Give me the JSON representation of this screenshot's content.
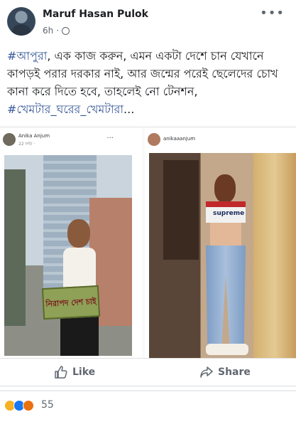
{
  "post": {
    "author": "Maruf Hasan Pulok",
    "time": "6h",
    "dot": "·",
    "more": "•••",
    "text": {
      "hashtag1": "#আপুরা",
      "body": ", এক কাজ করুন, এমন একটা দেশে চান যেখানে কাপড়ই পরার দরকার নাই, আর জন্মের পরেই ছেলেদের চোখ কানা করে দিতে হবে, তাহলেই নো টেনশন, ",
      "hashtag2": "#খেমটার_ঘরের_খেমটারা",
      "ellipsis": "..."
    }
  },
  "shared": {
    "left": {
      "name": "Anika Anjum",
      "time": "22 ঘন্টা · ",
      "dots": "···",
      "sign_text": "নিরাপদ দেশ চাই"
    },
    "right": {
      "username": "anikaaanjum",
      "top_text": "supreme"
    }
  },
  "actions": {
    "like_label": "Like",
    "share_label": "Share"
  },
  "reactions": {
    "count": "55",
    "types": [
      "haha-icon",
      "like-icon",
      "angry-icon"
    ]
  },
  "colors": {
    "hashtag": "#385898",
    "action_text": "#606770",
    "like": "#1877f2",
    "haha": "#f7b125",
    "angry": "#e9710f"
  }
}
